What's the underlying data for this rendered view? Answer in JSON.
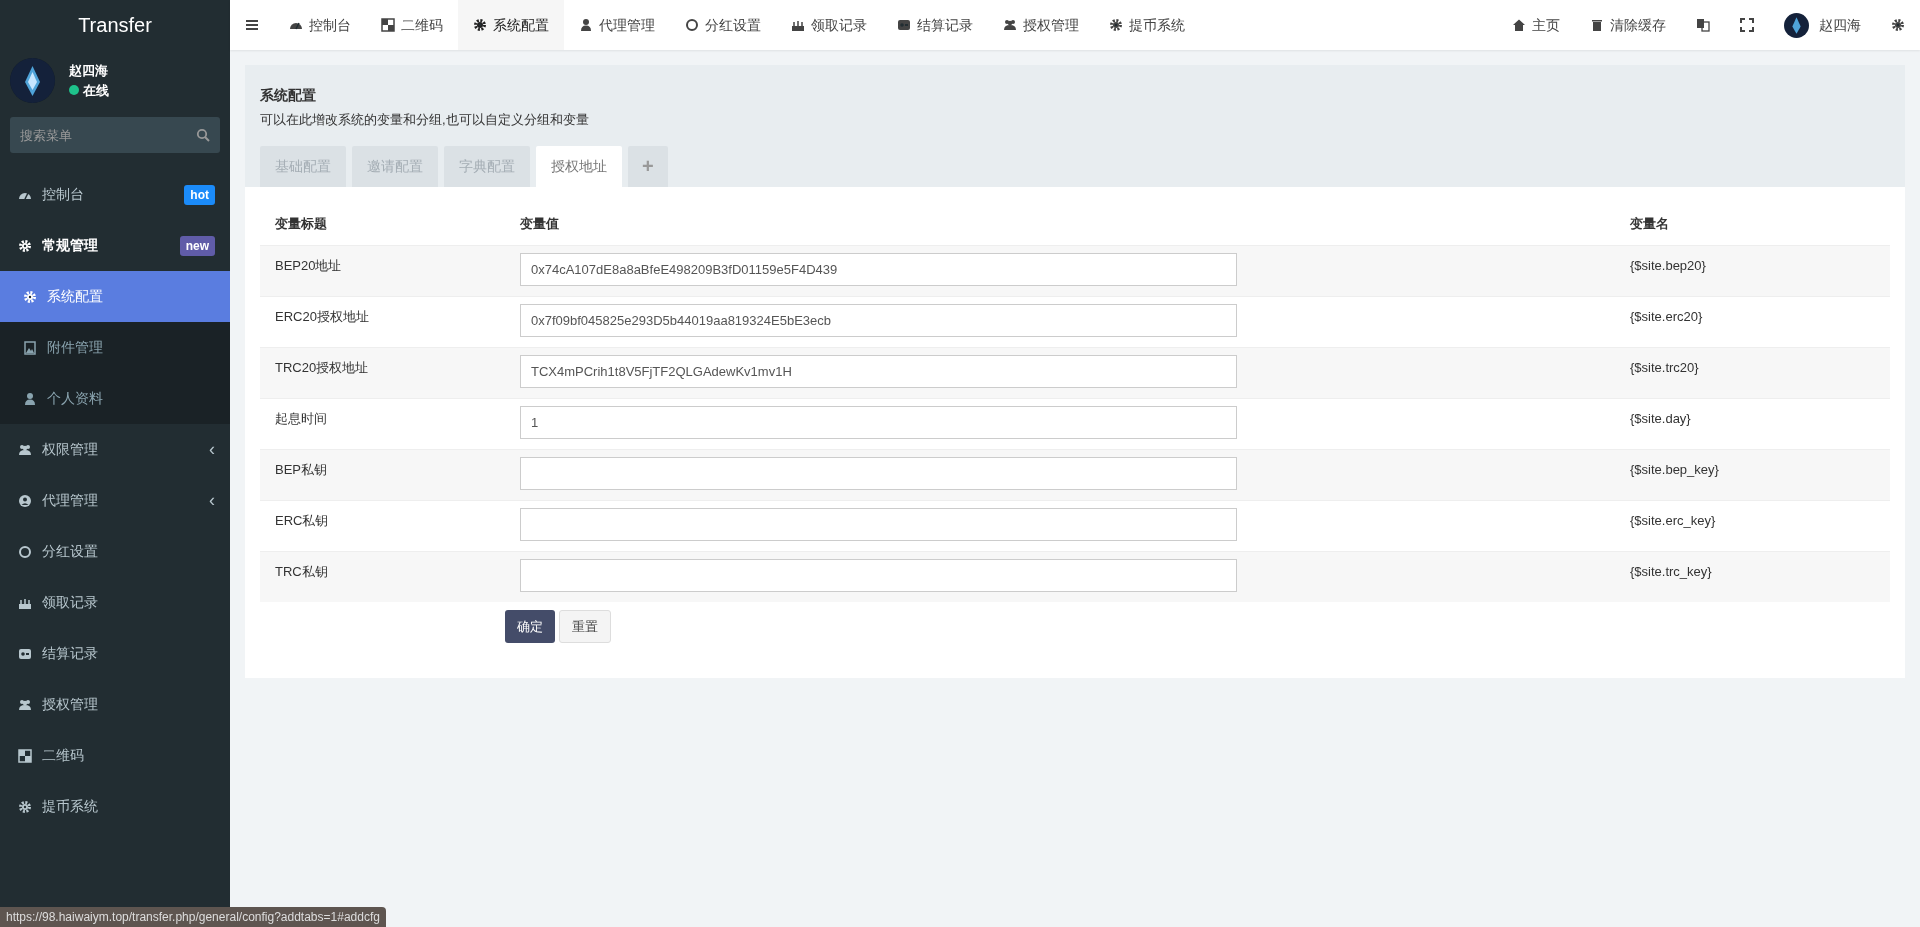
{
  "sidebar": {
    "logo": "Transfer",
    "user": {
      "name": "赵四海",
      "status": "在线",
      "online": true
    },
    "search": {
      "placeholder": "搜索菜单"
    },
    "items": [
      {
        "label": "控制台",
        "badge": "hot",
        "color": "#1b8bf9",
        "expanded": false
      },
      {
        "label": "常规管理",
        "badge": "new",
        "color": "#605ca8",
        "expanded": true,
        "children": [
          {
            "label": "系统配置",
            "selected": true
          },
          {
            "label": "附件管理",
            "selected": false
          },
          {
            "label": "个人资料",
            "selected": false
          }
        ]
      },
      {
        "label": "权限管理",
        "caret": "‹",
        "expanded": false
      },
      {
        "label": "代理管理",
        "caret": "‹",
        "expanded": false
      },
      {
        "label": "分红设置",
        "expanded": false
      },
      {
        "label": "领取记录",
        "expanded": false
      },
      {
        "label": "结算记录",
        "expanded": false
      },
      {
        "label": "授权管理",
        "expanded": false
      },
      {
        "label": "二维码",
        "expanded": false
      },
      {
        "label": "提币系统",
        "expanded": false
      }
    ]
  },
  "topbar": {
    "tabs": [
      {
        "label": "控制台",
        "selected": false
      },
      {
        "label": "二维码",
        "selected": false
      },
      {
        "label": "系统配置",
        "selected": true
      },
      {
        "label": "代理管理",
        "selected": false
      },
      {
        "label": "分红设置",
        "selected": false
      },
      {
        "label": "领取记录",
        "selected": false
      },
      {
        "label": "结算记录",
        "selected": false
      },
      {
        "label": "授权管理",
        "selected": false
      },
      {
        "label": "提币系统",
        "selected": false
      }
    ],
    "links": [
      "主页",
      "清除缓存"
    ],
    "user": "赵四海"
  },
  "panel": {
    "title": "系统配置",
    "description": "可以在此增改系统的变量和分组,也可以自定义分组和变量",
    "tabs": [
      {
        "label": "基础配置",
        "selected": false
      },
      {
        "label": "邀请配置",
        "selected": false
      },
      {
        "label": "字典配置",
        "selected": false
      },
      {
        "label": "授权地址",
        "selected": true
      }
    ],
    "add_tab": "+",
    "table": {
      "columns": [
        "变量标题",
        "变量值",
        "变量名"
      ],
      "rows": [
        {
          "title": "BEP20地址",
          "value": "0x74cA107dE8a8aBfeE498209B3fD01159e5F4D439",
          "variable": "{$site.bep20}"
        },
        {
          "title": "ERC20授权地址",
          "value": "0x7f09bf045825e293D5b44019aa819324E5bE3ecb",
          "variable": "{$site.erc20}"
        },
        {
          "title": "TRC20授权地址",
          "value": "TCX4mPCrih1t8V5FjTF2QLGAdewKv1mv1H",
          "variable": "{$site.trc20}"
        },
        {
          "title": "起息时间",
          "value": "1",
          "variable": "{$site.day}"
        },
        {
          "title": "BEP私钥",
          "value": "",
          "variable": "{$site.bep_key}"
        },
        {
          "title": "ERC私钥",
          "value": "",
          "variable": "{$site.erc_key}"
        },
        {
          "title": "TRC私钥",
          "value": "",
          "variable": "{$site.trc_key}"
        }
      ]
    },
    "buttons": [
      {
        "label": "确定",
        "kind": "primary"
      },
      {
        "label": "重置",
        "kind": "secondary"
      }
    ]
  },
  "status_bar": "https://98.haiwaiym.top/transfer.php/general/config?addtabs=1#addcfg"
}
